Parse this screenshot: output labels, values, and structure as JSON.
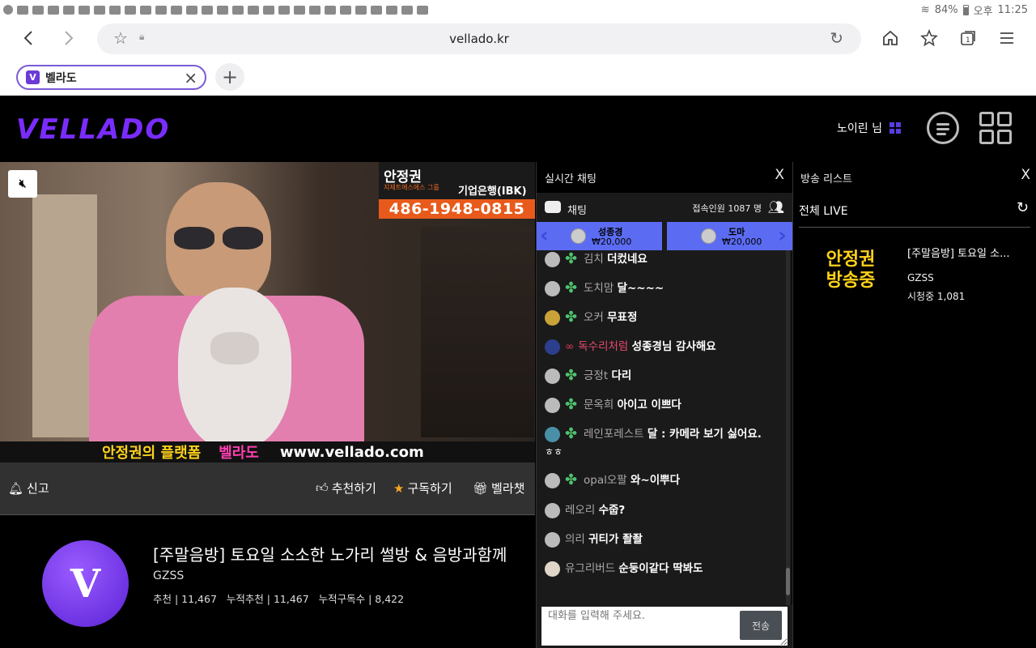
{
  "statusbar": {
    "battery": "84%",
    "ampm": "오후",
    "time": "11:25"
  },
  "browser": {
    "url": "vellado.kr",
    "tab_title": "벨라도",
    "new_tab": "+"
  },
  "site": {
    "logo": "VELLADO",
    "user_name": "노이린 님"
  },
  "video": {
    "ad_name": "안정권",
    "ad_sub": "지제트에스에스 그룹",
    "ad_bank": "기업은행(IBK)",
    "ad_phone": "486-1948-0815",
    "banner_a": "안정권의 플랫폼",
    "banner_b": "벨라도",
    "banner_c": "www.vellado.com"
  },
  "actions": {
    "report": "신고",
    "recommend": "추천하기",
    "subscribe": "구독하기",
    "vellachat": "벨라챗"
  },
  "stream": {
    "title": "[주말음방] 토요일 소소한 노가리 썰방 & 음방과함께",
    "streamer": "GZSS",
    "stats": "추천 | 11,467   누적추천 | 11,467   누적구독수 | 8,422"
  },
  "chat": {
    "title": "실시간 채팅",
    "close": "X",
    "label": "채팅",
    "viewers": "접속인원 1087 명",
    "donations": [
      {
        "name": "성종경",
        "amount": "₩20,000"
      },
      {
        "name": "도마",
        "amount": "₩20,000"
      }
    ],
    "messages": [
      {
        "nick": "김치",
        "text": "더컸네요"
      },
      {
        "nick": "도치맘",
        "text": "달~~~~"
      },
      {
        "nick": "오커",
        "text": "무표정"
      },
      {
        "nick": "독수리처럼",
        "text": "성종경님 감사해요"
      },
      {
        "nick": "긍정t",
        "text": "다리"
      },
      {
        "nick": "문옥희",
        "text": "아이고 이쁘다"
      },
      {
        "nick": "레인포레스트",
        "text": "달 : 카메라 보기 싫어요."
      },
      {
        "nick": "",
        "text": "ㅎㅎ"
      },
      {
        "nick": "opal오팔",
        "text": "와~이뿌다"
      },
      {
        "nick": "레오리",
        "text": "수줍?"
      },
      {
        "nick": "의리",
        "text": "귀티가 좔좔"
      },
      {
        "nick": "유그리버드",
        "text": "순둥이같다 딱봐도"
      }
    ],
    "input_placeholder": "대화를 입력해 주세요.",
    "send": "전송"
  },
  "broadcast_list": {
    "title": "방송 리스트",
    "close": "X",
    "all_live": "전체 LIVE",
    "item": {
      "thumb_line1": "안정권",
      "thumb_line2": "방송중",
      "title": "[주말음방] 토요일 소...",
      "streamer": "GZSS",
      "viewers": "시청중 1,081"
    }
  },
  "colors": {
    "accent": "#7a2cff",
    "donation": "#5c6cf2",
    "clover": "#4fc36e",
    "star": "#f5a623"
  }
}
